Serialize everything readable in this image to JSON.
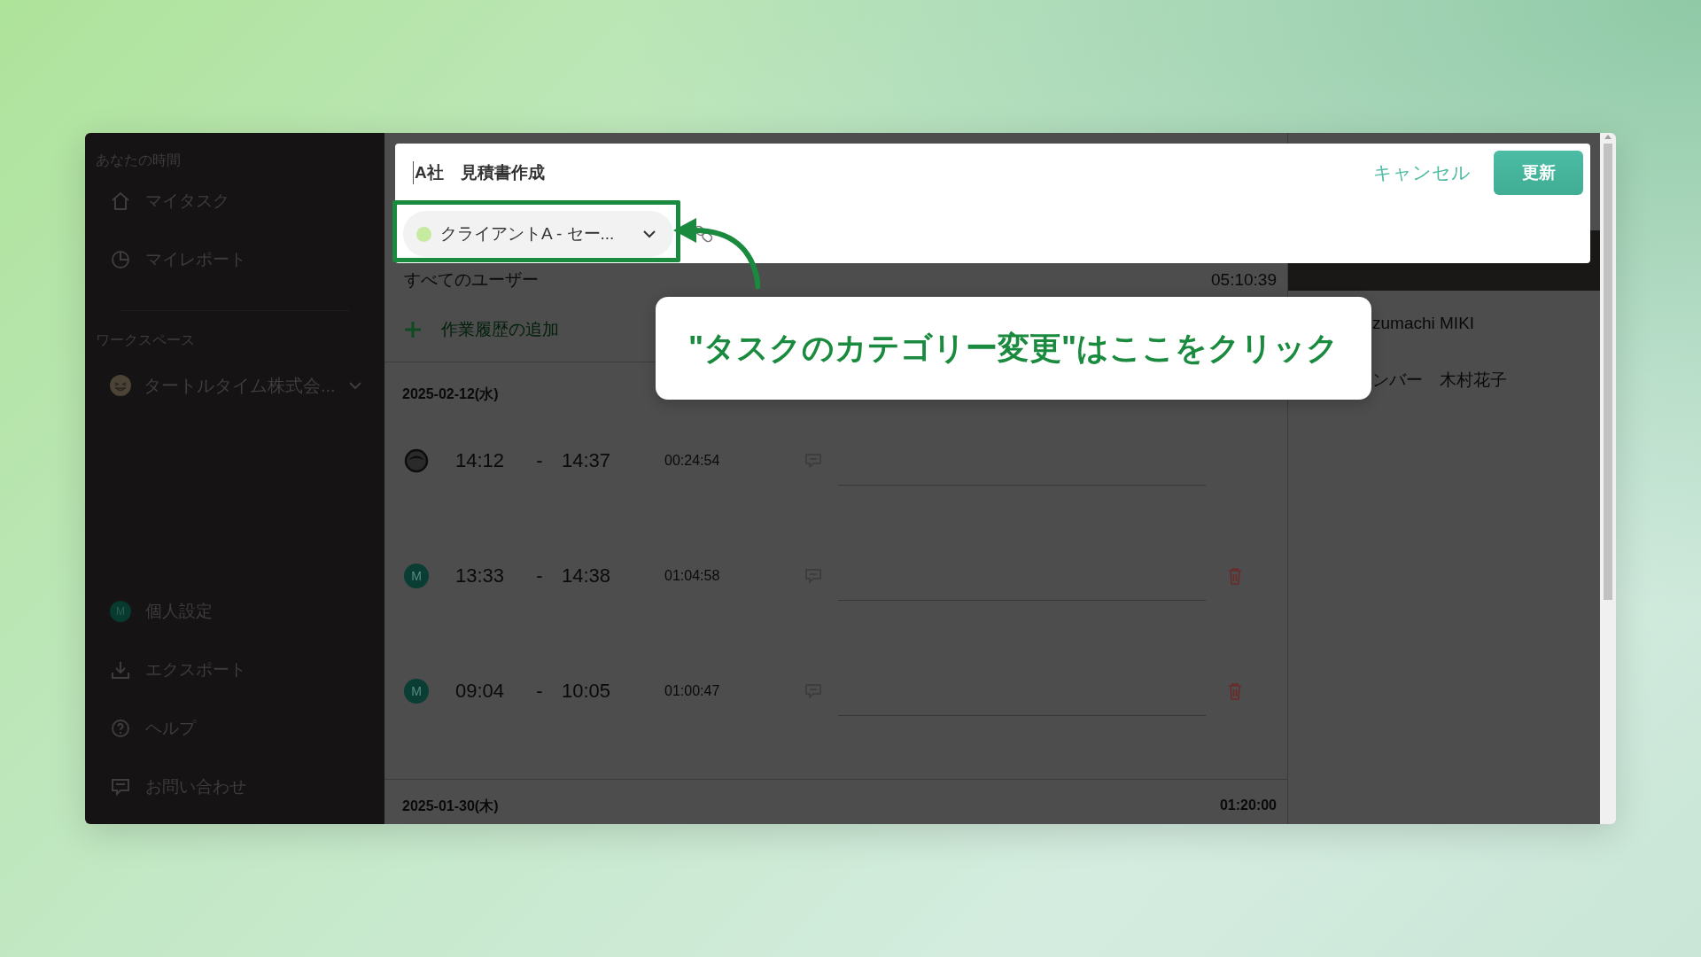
{
  "sidebar": {
    "section_title": "あなたの時間",
    "nav": [
      {
        "label": "マイタスク",
        "kind": "home"
      },
      {
        "label": "マイレポート",
        "kind": "report"
      }
    ],
    "workspace_title": "ワークスペース",
    "workspace": {
      "name": "タートルタイム株式会..."
    },
    "bottom": [
      {
        "label": "個人設定",
        "kind": "avatar",
        "avatar": "M"
      },
      {
        "label": "エクスポート",
        "kind": "download"
      },
      {
        "label": "ヘルプ",
        "kind": "help"
      },
      {
        "label": "お問い合わせ",
        "kind": "chat"
      }
    ]
  },
  "editor": {
    "task_name": "A社　見積書作成",
    "category": {
      "label": "クライアントA - セー...",
      "color": "#c5eaa0"
    },
    "cancel": "キャンセル",
    "submit": "更新"
  },
  "main": {
    "filter": "すべてのユーザー",
    "total": "05:10:39",
    "add": "作業履歴の追加",
    "days": [
      {
        "date": "2025-02-12(水)",
        "entries": [
          {
            "avatar": {
              "kind": "face"
            },
            "start": "14:12",
            "separator": "-",
            "end": "14:37",
            "duration": "00:24:54",
            "deletable": false
          },
          {
            "avatar": {
              "kind": "initial",
              "text": "M"
            },
            "start": "13:33",
            "separator": "-",
            "end": "14:38",
            "duration": "01:04:58",
            "deletable": true
          },
          {
            "avatar": {
              "kind": "initial",
              "text": "M"
            },
            "start": "09:04",
            "separator": "-",
            "end": "10:05",
            "duration": "01:00:47",
            "deletable": true
          }
        ]
      },
      {
        "date": "2025-01-30(木)",
        "total": "01:20:00"
      }
    ]
  },
  "right_panel": {
    "name": "zumachi MIKI",
    "member": "ンバー　木村花子"
  },
  "callout": {
    "text": "\"タスクのカテゴリー変更\"はここをクリック"
  }
}
